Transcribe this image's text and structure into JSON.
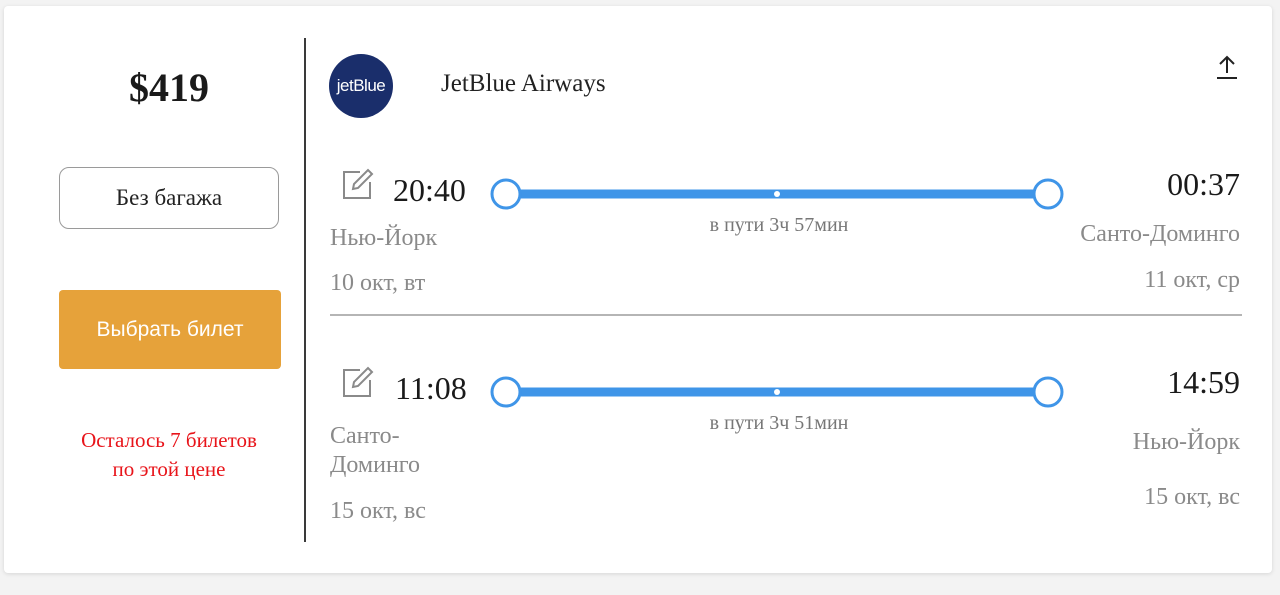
{
  "offer": {
    "price": "$419",
    "baggage_label": "Без багажа",
    "select_label": "Выбрать билет",
    "tickets_left_line1": "Осталось 7 билетов",
    "tickets_left_line2": "по этой цене"
  },
  "airline": {
    "logo_text": "jetBlue",
    "name": "JetBlue Airways",
    "logo_color": "#1a2e6b"
  },
  "segments": [
    {
      "dep_time": "20:40",
      "arr_time": "00:37",
      "dep_city": "Нью-Йорк",
      "arr_city": "Санто-Доминго",
      "dep_date": "10 окт, вт",
      "arr_date": "11 окт, ср",
      "duration": "в пути 3ч 57мин"
    },
    {
      "dep_time": "11:08",
      "arr_time": "14:59",
      "dep_city_line1": "Санто-",
      "dep_city_line2": "Доминго",
      "arr_city": "Нью-Йорк",
      "dep_date": "15 окт, вс",
      "arr_date": "15 окт, вс",
      "duration": "в пути 3ч 51мин"
    }
  ],
  "colors": {
    "accent_button": "#e6a23a",
    "track": "#3f95e8",
    "warning": "#e8141a"
  },
  "icons": {
    "share": "share-icon",
    "edit": "edit-icon"
  }
}
